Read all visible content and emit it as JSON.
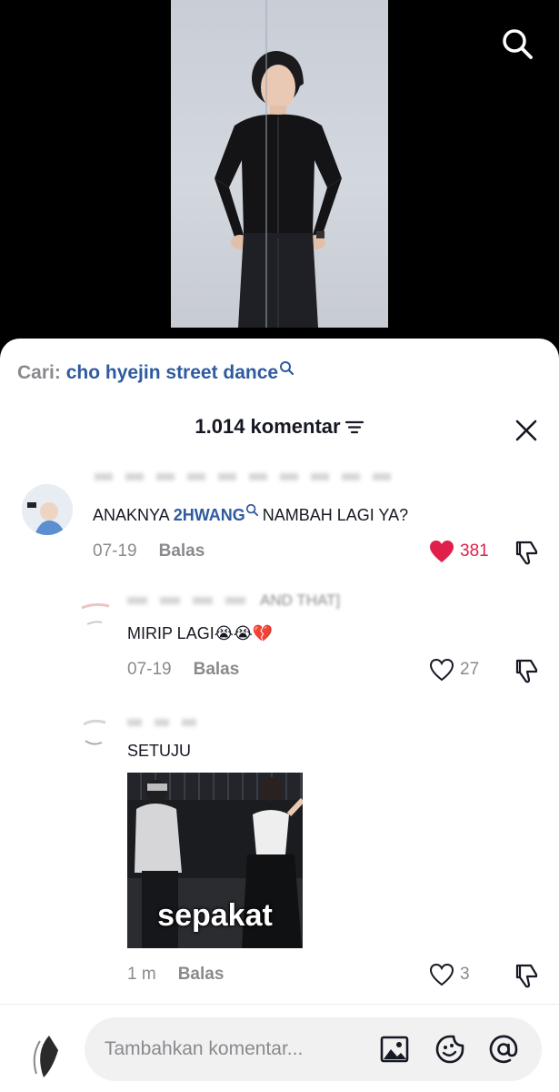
{
  "video": {
    "search_icon": "search-icon"
  },
  "sheet": {
    "search_label": "Cari:",
    "search_query": "cho hyejin street dance",
    "comment_count": "1.014 komentar",
    "close_icon": "close-icon",
    "filter_icon": "sort-icon"
  },
  "comments": [
    {
      "username": "",
      "text_before": "ANAKNYA ",
      "mention": "2HWANG",
      "text_after": " NAMBAH LAGI YA?",
      "date": "07-19",
      "reply_label": "Balas",
      "likes": "381",
      "liked": true
    },
    {
      "username": "AND THAT]",
      "text": "MIRIP LAGI😭😭💔",
      "date": "07-19",
      "reply_label": "Balas",
      "likes": "27",
      "liked": false
    },
    {
      "username": "",
      "text": "SETUJU",
      "gif_caption": "sepakat",
      "date": "1 m",
      "reply_label": "Balas",
      "likes": "3",
      "liked": false
    }
  ],
  "composer": {
    "placeholder": "Tambahkan komentar...",
    "icons": [
      "image-icon",
      "emoji-icon",
      "mention-icon"
    ]
  },
  "colors": {
    "accent_link": "#2f5a9e",
    "like_red": "#e0204a",
    "muted": "#8a8a8e"
  }
}
